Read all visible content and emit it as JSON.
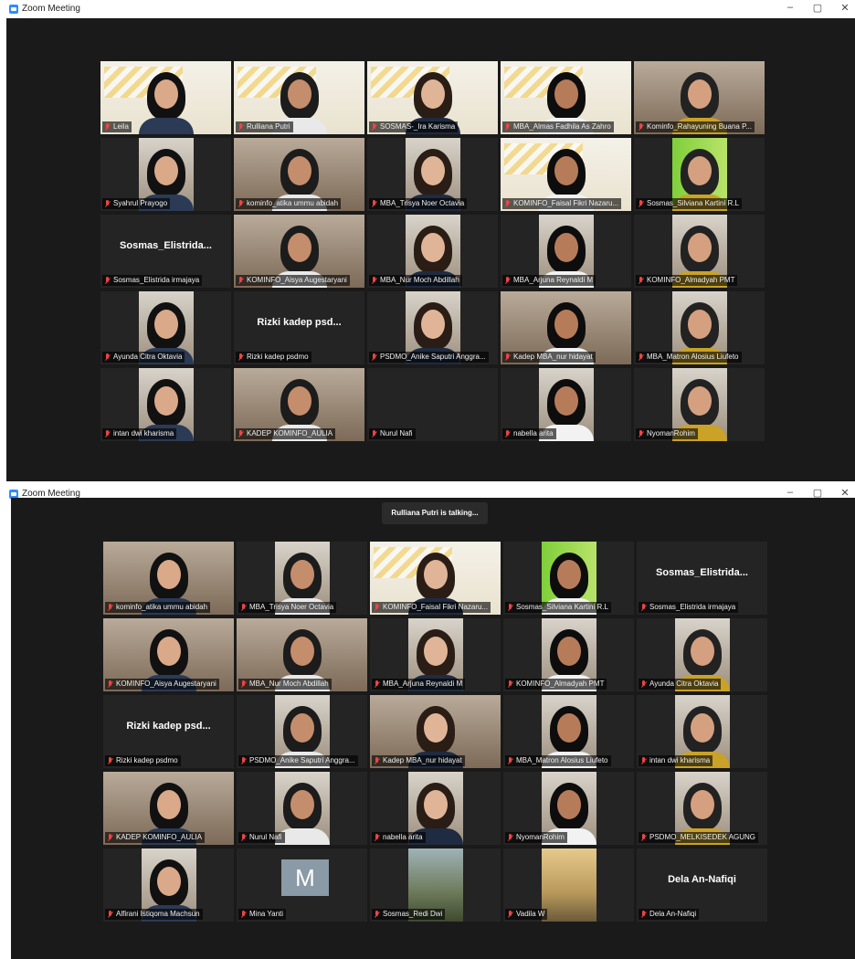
{
  "window": {
    "title": "Zoom Meeting",
    "controls": {
      "minimize": "–",
      "restore": "▢",
      "close": "✕"
    }
  },
  "talking_indicator": "Rulliana Putri is talking...",
  "gallery_1": [
    {
      "label": "Leila",
      "style": "banner",
      "active": false
    },
    {
      "label": "Rulliana Putri",
      "style": "banner",
      "active": true
    },
    {
      "label": "SOSMAS-_Ira Karisma",
      "style": "banner",
      "active": false
    },
    {
      "label": "MBA_Almas Fadhila As Zahro",
      "style": "banner",
      "active": false
    },
    {
      "label": "Kominfo_Rahayuning Buana P...",
      "style": "room",
      "active": false
    },
    {
      "label": "Syahrul Prayogo",
      "style": "narrow",
      "active": false
    },
    {
      "label": "kominfo_atika ummu abidah",
      "style": "room",
      "active": false
    },
    {
      "label": "MBA_Trisya Noer Octavia",
      "style": "narrow",
      "active": false
    },
    {
      "label": "KOMINFO_Faisal Fikri Nazaru...",
      "style": "banner",
      "active": false
    },
    {
      "label": "Sosmas_Silviana Kartini R.L",
      "style": "green",
      "active": false
    },
    {
      "label": "Sosmas_Elistrida irmajaya",
      "style": "name",
      "bigname": "Sosmas_Elistrida...",
      "active": false
    },
    {
      "label": "KOMINFO_Aisya Augestaryani",
      "style": "room",
      "active": false
    },
    {
      "label": "MBA_Nur Moch Abdillah",
      "style": "narrow",
      "active": false
    },
    {
      "label": "MBA_Arjuna Reynaldi M",
      "style": "narrow",
      "active": false
    },
    {
      "label": "KOMINFO_Almadyah PMT",
      "style": "narrow",
      "active": false
    },
    {
      "label": "Ayunda Citra Oktavia",
      "style": "narrow",
      "active": false
    },
    {
      "label": "Rizki kadep psdmo",
      "style": "name",
      "bigname": "Rizki kadep psd...",
      "active": false
    },
    {
      "label": "PSDMO_Anike Saputri Anggra...",
      "style": "narrow",
      "active": false
    },
    {
      "label": "Kadep MBA_nur hidayat",
      "style": "room",
      "active": false
    },
    {
      "label": "MBA_Matron Alosius Liufeto",
      "style": "narrow",
      "active": false
    },
    {
      "label": "intan dwi kharisma",
      "style": "narrow",
      "active": false
    },
    {
      "label": "KADEP KOMINFO_AULIA",
      "style": "room",
      "active": false
    },
    {
      "label": "Nurul Nafi",
      "style": "empty",
      "active": false
    },
    {
      "label": "nabella arita",
      "style": "narrow",
      "active": false
    },
    {
      "label": "NyomanRohim",
      "style": "narrow",
      "active": false
    }
  ],
  "gallery_2": [
    {
      "label": "kominfo_atika ummu abidah",
      "style": "room",
      "active": false
    },
    {
      "label": "MBA_Trisya Noer Octavia",
      "style": "narrow",
      "active": false
    },
    {
      "label": "KOMINFO_Faisal Fikri Nazaru...",
      "style": "banner",
      "active": false
    },
    {
      "label": "Sosmas_Silviana Kartini R.L",
      "style": "green",
      "active": false
    },
    {
      "label": "Sosmas_Elistrida irmajaya",
      "style": "name",
      "bigname": "Sosmas_Elistrida...",
      "active": false
    },
    {
      "label": "KOMINFO_Aisya Augestaryani",
      "style": "room",
      "active": false
    },
    {
      "label": "MBA_Nur Moch Abdillah",
      "style": "room",
      "active": false
    },
    {
      "label": "MBA_Arjuna Reynaldi M",
      "style": "narrow",
      "active": false
    },
    {
      "label": "KOMINFO_Almadyah PMT",
      "style": "narrow",
      "active": false
    },
    {
      "label": "Ayunda Citra Oktavia",
      "style": "narrow",
      "active": false
    },
    {
      "label": "Rizki kadep psdmo",
      "style": "name",
      "bigname": "Rizki kadep psd...",
      "active": false
    },
    {
      "label": "PSDMO_Anike Saputri Anggra...",
      "style": "narrow",
      "active": false
    },
    {
      "label": "Kadep MBA_nur hidayat",
      "style": "room",
      "active": false
    },
    {
      "label": "MBA_Matron Alosius Liufeto",
      "style": "narrow",
      "active": false
    },
    {
      "label": "intan dwi kharisma",
      "style": "narrow",
      "active": false
    },
    {
      "label": "KADEP KOMINFO_AULIA",
      "style": "room",
      "active": false
    },
    {
      "label": "Nurul Nafi",
      "style": "narrow",
      "active": false
    },
    {
      "label": "nabella arita",
      "style": "narrow",
      "active": false
    },
    {
      "label": "NyomanRohim",
      "style": "narrow",
      "active": false
    },
    {
      "label": "PSDMO_MELKISEDEK AGUNG",
      "style": "narrow",
      "active": false
    },
    {
      "label": "Alfirani Istiqoma Machsun",
      "style": "narrow",
      "active": false
    },
    {
      "label": "Mina Yanti",
      "style": "avatar",
      "avatar": "M",
      "active": false
    },
    {
      "label": "Sosmas_Redi Dwi",
      "style": "landscape",
      "active": false
    },
    {
      "label": "Vadila W",
      "style": "landscape2",
      "active": false
    },
    {
      "label": "Dela An-Nafiqi",
      "style": "name",
      "bigname": "Dela An-Nafiqi",
      "active": false
    }
  ],
  "colors": {
    "meeting_bg": "#1a1a1a",
    "tile_bg": "#242424",
    "active_speaker_border": "#c3d93b",
    "muted_icon": "#ee4444",
    "zoom_blue": "#2d8cff"
  }
}
